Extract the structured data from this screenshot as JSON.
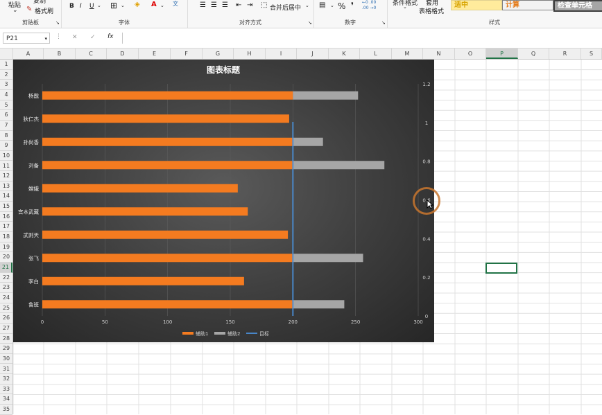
{
  "ribbon": {
    "paste": "粘贴",
    "copy": "复制",
    "format_painter": "格式刷",
    "clipboard_group": "剪贴板",
    "font_group": "字体",
    "bold": "B",
    "italic": "I",
    "underline": "U",
    "alignment_group": "对齐方式",
    "merge_center": "合并后居中",
    "number_group": "数字",
    "percent": "%",
    "comma": "❜",
    "decimal_increase": "←0 .00",
    "decimal_decrease": ".00 →0",
    "conditional_format": "条件格式",
    "table_format_line1": "套用",
    "table_format_line2": "表格格式",
    "styles_group": "样式",
    "style_neutral": "适中",
    "style_calc": "计算",
    "style_check": "检查单元格"
  },
  "formula_bar": {
    "name_box": "P21",
    "cancel": "✕",
    "enter": "✓",
    "fx": "fx",
    "content": ""
  },
  "columns": [
    "A",
    "B",
    "C",
    "D",
    "E",
    "F",
    "G",
    "H",
    "I",
    "J",
    "K",
    "L",
    "M",
    "N",
    "O",
    "P",
    "Q",
    "R",
    "S"
  ],
  "rows": [
    "1",
    "2",
    "3",
    "4",
    "5",
    "6",
    "7",
    "8",
    "9",
    "10",
    "11",
    "12",
    "13",
    "14",
    "15",
    "16",
    "17",
    "18",
    "19",
    "20",
    "21",
    "22",
    "23",
    "24",
    "25",
    "26",
    "27",
    "28",
    "29",
    "30",
    "31",
    "32",
    "33",
    "34",
    "35"
  ],
  "chart_data": {
    "type": "bar",
    "title": "图表标题",
    "categories": [
      "杨戬",
      "狄仁杰",
      "孙尚香",
      "刘备",
      "嫦娥",
      "宫本武藏",
      "武则天",
      "张飞",
      "李白",
      "鲁班"
    ],
    "series": [
      {
        "name": "辅助1",
        "values": [
          200,
          197,
          200,
          200,
          156,
          164,
          196,
          200,
          161,
          200
        ],
        "color": "#f47b20"
      },
      {
        "name": "辅助2",
        "values": [
          52,
          0,
          24,
          73,
          0,
          0,
          0,
          56,
          0,
          41
        ],
        "color": "#a6a6a6"
      },
      {
        "name": "目标",
        "values": [
          200
        ],
        "color": "#4a90d9"
      }
    ],
    "x_ticks": [
      "0",
      "50",
      "100",
      "150",
      "200",
      "250",
      "300"
    ],
    "xlim": [
      0,
      300
    ],
    "y2_ticks": [
      "0",
      "0.2",
      "0.4",
      "0.6",
      "0.8",
      "1",
      "1.2"
    ],
    "y2lim": [
      0,
      1.2
    ],
    "stacked": true,
    "legend_position": "bottom"
  }
}
